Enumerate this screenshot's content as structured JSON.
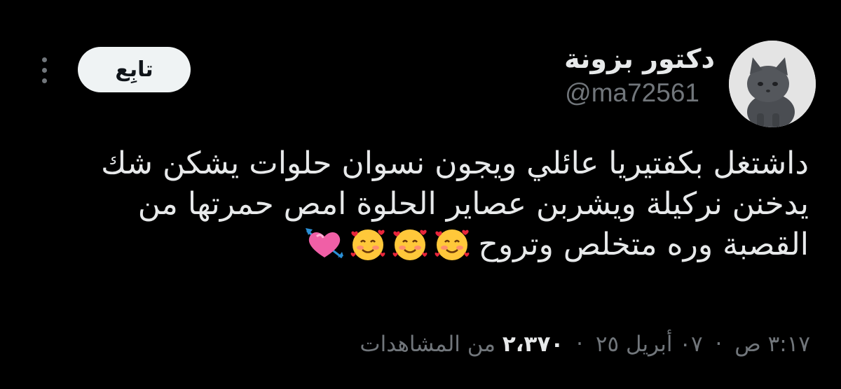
{
  "author": {
    "display_name": "دكتور بزونة",
    "handle": "@ma72561",
    "avatar_icon": "kitten-avatar"
  },
  "actions": {
    "follow_label": "تابِع",
    "more_icon": "more-vertical-icon"
  },
  "tweet": {
    "lines": [
      "داشتغل بكفتيريا عائلي ويجون نسوان حلوات يشكن شك",
      "يدخنن نركيلة ويشربن عصاير الحلوة امص حمرتها من",
      "القصبة وره متخلص وتروح"
    ],
    "emojis": [
      "smiling-face-with-hearts",
      "smiling-face-with-hearts",
      "smiling-face-with-hearts",
      "heart-with-arrow"
    ]
  },
  "meta": {
    "time": "٣:١٧ ص",
    "date": "٠٧ أبريل ٢٥",
    "separator": "·",
    "views_count": "٢،٣٧٠",
    "views_label": "من المشاهدات"
  },
  "colors": {
    "background": "#000000",
    "primary_text": "#e7e9ea",
    "secondary_text": "#71767b",
    "button_bg": "#eff3f4"
  }
}
